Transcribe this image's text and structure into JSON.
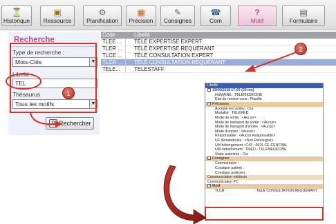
{
  "toolbar": {
    "buttons": [
      {
        "label": "Historique",
        "icon": "history-icon"
      },
      {
        "label": "Ressource",
        "icon": "resource-icon"
      },
      {
        "label": "Planification",
        "icon": "planning-icon"
      },
      {
        "label": "Précision",
        "icon": "precision-icon"
      },
      {
        "label": "Consignes",
        "icon": "consignes-icon"
      },
      {
        "label": "Com",
        "icon": "com-icon"
      },
      {
        "label": "Motif",
        "icon": "question-icon"
      },
      {
        "label": "Formulaire",
        "icon": "form-icon"
      }
    ],
    "active": "Motif"
  },
  "search": {
    "title": "Recherche",
    "type_label": "Type de recherche :",
    "type_value": "Mots-Clés",
    "libelle_label": "Libellé :",
    "libelle_value": "TEL",
    "thesaurus_label": "Thésaurus",
    "thesaurus_value": "Tous les motifs",
    "button_label": "Rechercher",
    "marker": "1"
  },
  "results": {
    "headers": [
      "Code",
      "Libellé"
    ],
    "rows": [
      {
        "code": "TLEE ...",
        "label": "TÉLÉ EXPERTISE EXPERT"
      },
      {
        "code": "TLER ...",
        "label": "TÉLÉ EXPERTISE REQUÉRANT"
      },
      {
        "code": "TLCE ...",
        "label": "TÉLÉ CONSULTATION EXPERT"
      },
      {
        "code": "TLCR ...",
        "label": "TÉLÉ CONSULTATION REQUÉRANT",
        "selected": true
      },
      {
        "code": "TELE...",
        "label": "TELESTAFF"
      }
    ],
    "marker": "2"
  },
  "detail": {
    "header": "Libellé",
    "date": "19/06/2018 17:00 (30 mn)",
    "lines_top": [
      "HUMAINE : TELEMEDECINE",
      "Etat du rendez-vous : Planifié"
    ],
    "section_precisions": "Précisions",
    "precisions": [
      "Accepte les visites : Oui",
      "Modalité : TELEMED",
      "Mode de sortie : <Aucun>",
      "Mode de transport de sortie : <Aucun>",
      "Mode de transport d'entrée : <Aucun>",
      "Mode d'entrée : <Aucun>",
      "Responsable : <Aucun Responsable>",
      "UF demandeuse : <Non Renseigné>",
      "UM hébergement : C43 - 0621 CE-CENTRAL",
      "UM rattachement : TMED - TELEMEDECINE",
      "Visite autorisée : Oui"
    ],
    "section_consignes": "Consignes",
    "consignes": [
      "Commentaire :",
      "Consigne patient :",
      "Consigne praticien :"
    ],
    "communication_medecin": "Communication médecin",
    "communication_pc": "Communication PC",
    "section_motif": "Motif",
    "motif_code": "TLCR",
    "motif_label": "TÉLÉ CONSULTATION REQUÉRANT"
  },
  "colors": {
    "annotation_red": "#d6312b",
    "title_pink": "#c24a8b",
    "selection_blue": "#98aed6",
    "detail_header_blue": "#3b5cb3",
    "section_tan": "#eacb9f",
    "arrow_dark_red": "#a0231c"
  }
}
